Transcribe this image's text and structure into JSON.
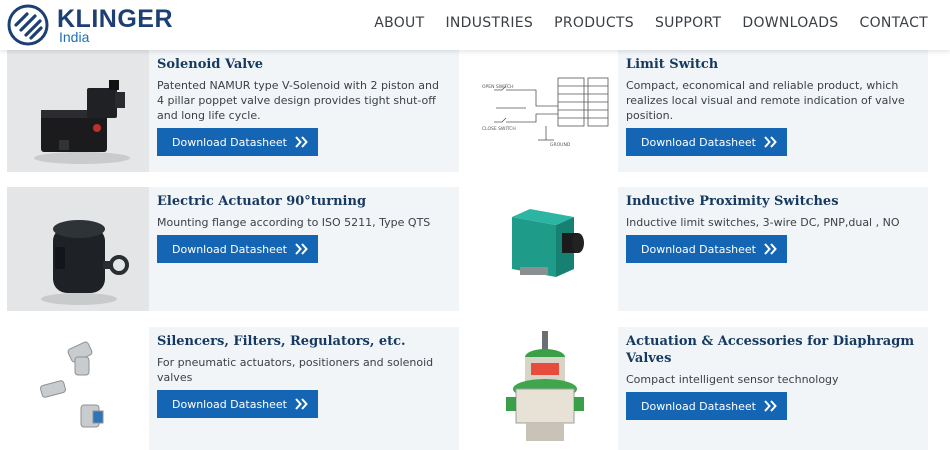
{
  "header": {
    "logo_text": "KLINGER",
    "logo_sub": "India",
    "nav": [
      "ABOUT",
      "INDUSTRIES",
      "PRODUCTS",
      "SUPPORT",
      "DOWNLOADS",
      "CONTACT"
    ]
  },
  "products": [
    {
      "title": "Solenoid Valve",
      "description": "Patented NAMUR type V-Solenoid with 2 piston and 4 pillar poppet valve design provides tight shut-off and long life cycle.",
      "button": "Download Datasheet"
    },
    {
      "title": "Limit Switch",
      "description": "Compact, economical and reliable product, which realizes local visual and remote indication of valve position.",
      "button": "Download Datasheet"
    },
    {
      "title": "Electric Actuator 90°turning",
      "description": "Mounting flange according to ISO 5211, Type QTS",
      "button": "Download Datasheet"
    },
    {
      "title": "Inductive Proximity Switches",
      "description": "Inductive limit switches, 3-wire DC, PNP,dual , NO",
      "button": "Download Datasheet"
    },
    {
      "title": "Silencers, Filters, Regulators, etc.",
      "description": "For pneumatic actuators, positioners and solenoid valves",
      "button": "Download Datasheet"
    },
    {
      "title": "Actuation & Accessories for Diaphragm Valves",
      "description": "Compact intelligent sensor technology",
      "button": "Download Datasheet"
    }
  ],
  "diagram_labels": {
    "open_switch": "OPEN SWITCH",
    "close_switch": "CLOSE SWITCH",
    "ground": "GROUND"
  }
}
